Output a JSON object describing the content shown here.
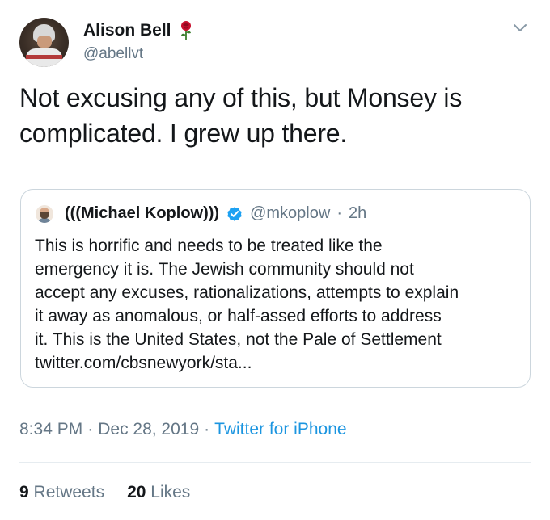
{
  "author": {
    "display_name": "Alison Bell",
    "handle": "@abellvt",
    "name_emoji": "rose-icon"
  },
  "tweet": {
    "text_lines": [
      "Not excusing any of this, but Monsey is",
      "complicated. I grew up there."
    ]
  },
  "quoted_tweet": {
    "display_name": "(((Michael Koplow)))",
    "handle": "@mkoplow",
    "separator": "·",
    "time": "2h",
    "verified": true,
    "body_lines": [
      "This is horrific and needs to be treated like the",
      "emergency it is. The Jewish community should not",
      "accept any excuses, rationalizations, attempts to explain",
      "it away as anomalous, or half-assed efforts to address",
      "it. This is the United States, not the Pale of Settlement",
      "twitter.com/cbsnewyork/sta..."
    ]
  },
  "meta": {
    "time": "8:34 PM",
    "sep1": "·",
    "date": "Dec 28, 2019",
    "sep2": "·",
    "source": "Twitter for iPhone"
  },
  "stats": {
    "retweets_count": "9",
    "retweets_label": "Retweets",
    "likes_count": "20",
    "likes_label": "Likes"
  },
  "colors": {
    "text_primary": "#14171a",
    "text_secondary": "#657786",
    "link": "#1b95e0",
    "verified": "#1da1f2",
    "border": "#ccd6dd"
  }
}
